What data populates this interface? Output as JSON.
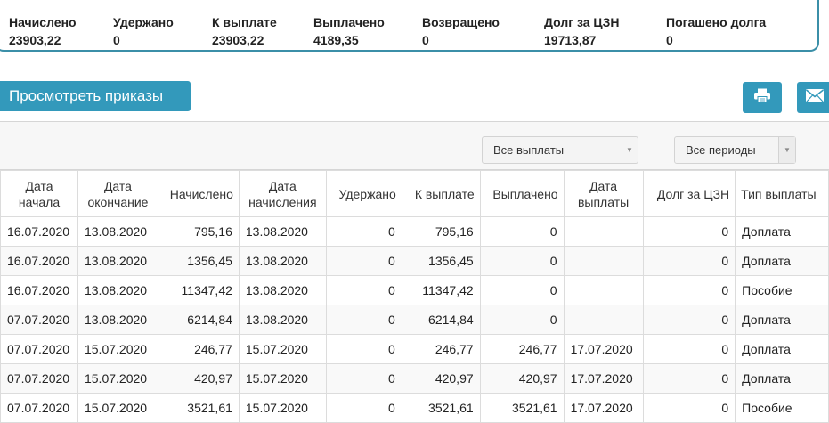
{
  "summary": [
    {
      "label": "Начислено",
      "value": "23903,22"
    },
    {
      "label": "Удержано",
      "value": "0"
    },
    {
      "label": "К выплате",
      "value": "23903,22"
    },
    {
      "label": "Выплачено",
      "value": "4189,35"
    },
    {
      "label": "Возвращено",
      "value": "0"
    },
    {
      "label": "Долг за ЦЗН",
      "value": "19713,87"
    },
    {
      "label": "Погашено долга",
      "value": "0"
    }
  ],
  "actions": {
    "view_orders_label": "Просмотреть приказы",
    "print_icon": "printer-icon",
    "email_icon": "envelope-icon"
  },
  "filters": {
    "payments_selected": "Все выплаты",
    "periods_selected": "Все периоды"
  },
  "colors": {
    "accent": "#3399bb",
    "panel_border": "#3b8fa8"
  },
  "table": {
    "headers": [
      "Дата начала",
      "Дата окончание",
      "Начислено",
      "Дата начисления",
      "Удержано",
      "К выплате",
      "Выплачено",
      "Дата выплаты",
      "Долг за ЦЗН",
      "Тип выплаты"
    ],
    "rows": [
      [
        "16.07.2020",
        "13.08.2020",
        "795,16",
        "13.08.2020",
        "0",
        "795,16",
        "0",
        "",
        "0",
        "Доплата"
      ],
      [
        "16.07.2020",
        "13.08.2020",
        "1356,45",
        "13.08.2020",
        "0",
        "1356,45",
        "0",
        "",
        "0",
        "Доплата"
      ],
      [
        "16.07.2020",
        "13.08.2020",
        "11347,42",
        "13.08.2020",
        "0",
        "11347,42",
        "0",
        "",
        "0",
        "Пособие"
      ],
      [
        "07.07.2020",
        "13.08.2020",
        "6214,84",
        "13.08.2020",
        "0",
        "6214,84",
        "0",
        "",
        "0",
        "Доплата"
      ],
      [
        "07.07.2020",
        "15.07.2020",
        "246,77",
        "15.07.2020",
        "0",
        "246,77",
        "246,77",
        "17.07.2020",
        "0",
        "Доплата"
      ],
      [
        "07.07.2020",
        "15.07.2020",
        "420,97",
        "15.07.2020",
        "0",
        "420,97",
        "420,97",
        "17.07.2020",
        "0",
        "Доплата"
      ],
      [
        "07.07.2020",
        "15.07.2020",
        "3521,61",
        "15.07.2020",
        "0",
        "3521,61",
        "3521,61",
        "17.07.2020",
        "0",
        "Пособие"
      ]
    ]
  }
}
